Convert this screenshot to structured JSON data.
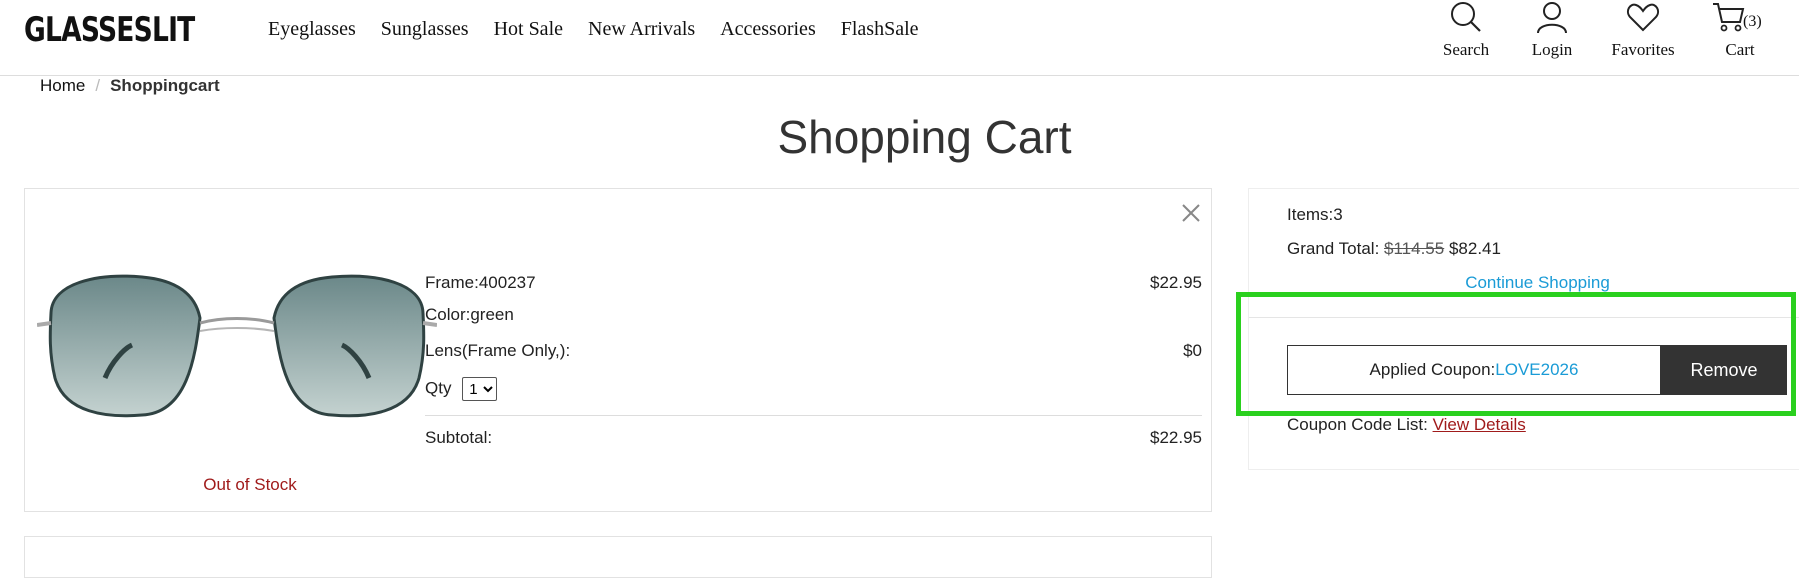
{
  "header": {
    "logo": "GLASSESLIT",
    "nav": [
      "Eyeglasses",
      "Sunglasses",
      "Hot Sale",
      "New Arrivals",
      "Accessories",
      "FlashSale"
    ],
    "icons": {
      "search": {
        "label": "Search",
        "icon": "search-icon"
      },
      "login": {
        "label": "Login",
        "icon": "user-icon"
      },
      "favorites": {
        "label": "Favorites",
        "icon": "heart-icon"
      },
      "cart": {
        "label": "Cart",
        "icon": "cart-icon",
        "count": "(3)"
      }
    }
  },
  "breadcrumb": {
    "home": "Home",
    "separator": "/",
    "current": "Shoppingcart"
  },
  "page_title": "Shopping Cart",
  "item": {
    "frame_label": "Frame:400237",
    "frame_price": "$22.95",
    "color_label": "Color:green",
    "lens_label": "Lens(Frame Only,):",
    "lens_price": "$0",
    "qty_label": "Qty",
    "qty_value": "1",
    "subtotal_label": "Subtotal:",
    "subtotal_value": "$22.95",
    "stock_status": "Out of Stock",
    "lens_color": "#6f8e8f"
  },
  "summary": {
    "items": "Items:3",
    "grand_total_label": "Grand Total:",
    "grand_total_original": "$114.55",
    "grand_total_final": "$82.41",
    "continue_shopping": "Continue Shopping",
    "applied_coupon_label": "Applied Coupon:",
    "coupon_code": "LOVE2026",
    "remove_label": "Remove",
    "coupon_list_label": "Coupon Code List:",
    "view_details": "View Details"
  },
  "colors": {
    "link": "#1a9bd6",
    "alert": "#a01b1b",
    "button": "#333333",
    "highlight": "#2ad01e"
  }
}
